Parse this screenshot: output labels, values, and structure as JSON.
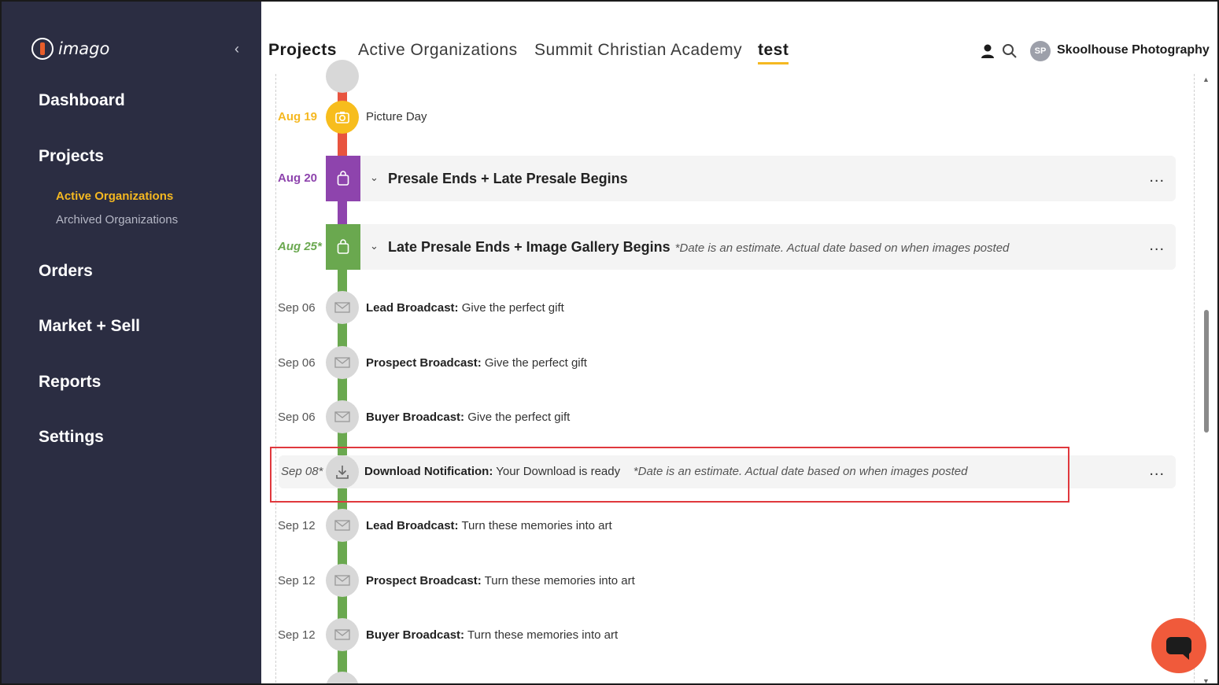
{
  "app": {
    "logo_text": "imago",
    "collapse_glyph": "‹"
  },
  "sidebar": {
    "items": [
      {
        "label": "Dashboard"
      },
      {
        "label": "Projects"
      },
      {
        "label": "Orders"
      },
      {
        "label": "Market + Sell"
      },
      {
        "label": "Reports"
      },
      {
        "label": "Settings"
      }
    ],
    "sub_items": [
      {
        "label": "Active Organizations",
        "active": true
      },
      {
        "label": "Archived Organizations",
        "active": false
      }
    ]
  },
  "header": {
    "breadcrumbs": [
      "Projects",
      "Active Organizations",
      "Summit Christian Academy",
      "test"
    ],
    "avatar_initials": "SP",
    "account_name": "Skoolhouse Photography",
    "icons": [
      "user-icon",
      "search-icon"
    ]
  },
  "timeline": {
    "rows": [
      {
        "date": "Aug 19",
        "text": "Picture Day",
        "icon": "camera-icon",
        "color": "#f7bd1d"
      },
      {
        "date": "Aug 20",
        "title": "Presale Ends + Late Presale Begins",
        "icon": "shopping-bag-icon",
        "color": "#8e44ad",
        "menu": "..."
      },
      {
        "date": "Aug 25*",
        "title": "Late Presale Ends + Image Gallery Begins",
        "note": "*Date is an estimate. Actual date based on when images posted",
        "icon": "shopping-bag-icon",
        "color": "#6aa84f",
        "menu": "..."
      },
      {
        "date": "Sep 06",
        "label": "Lead Broadcast:",
        "text": "Give the perfect gift",
        "icon": "envelope-icon"
      },
      {
        "date": "Sep 06",
        "label": "Prospect Broadcast:",
        "text": "Give the perfect gift",
        "icon": "envelope-icon"
      },
      {
        "date": "Sep 06",
        "label": "Buyer Broadcast:",
        "text": "Give the perfect gift",
        "icon": "envelope-icon"
      },
      {
        "date": "Sep 08*",
        "label": "Download Notification:",
        "text": "Your Download is ready",
        "note": "*Date is an estimate. Actual date based on when images posted",
        "icon": "download-icon",
        "menu": "..."
      },
      {
        "date": "Sep 12",
        "label": "Lead Broadcast:",
        "text": "Turn these memories into art",
        "icon": "envelope-icon"
      },
      {
        "date": "Sep 12",
        "label": "Prospect Broadcast:",
        "text": "Turn these memories into art",
        "icon": "envelope-icon"
      },
      {
        "date": "Sep 12",
        "label": "Buyer Broadcast:",
        "text": "Turn these memories into art",
        "icon": "envelope-icon"
      }
    ]
  },
  "colors": {
    "sidebar_bg": "#2b2d42",
    "accent": "#f5b821",
    "highlight_border": "#e0383d",
    "chat": "#f05a3b",
    "line_red": "#e8543f",
    "line_purple": "#8e44ad",
    "line_green": "#6aa84f"
  }
}
